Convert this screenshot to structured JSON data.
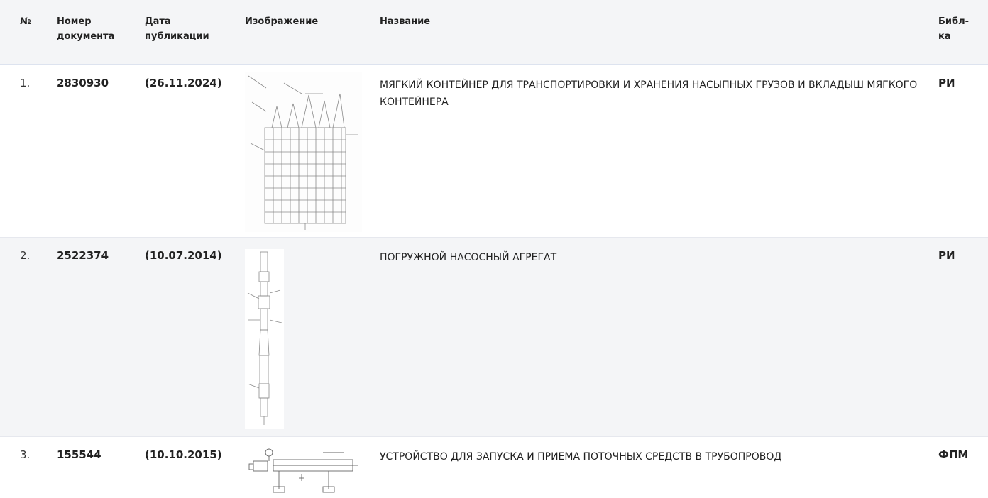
{
  "header": {
    "col_num": "№",
    "col_doc_line1": "Номер",
    "col_doc_line2": "документа",
    "col_date_line1": "Дата",
    "col_date_line2": "публикации",
    "col_image": "Изображение",
    "col_title": "Название",
    "col_lib_line1": "Библ-",
    "col_lib_line2": "ка"
  },
  "rows": [
    {
      "num": "1.",
      "doc": "2830930",
      "date": "(26.11.2024)",
      "title": "МЯГКИЙ КОНТЕЙНЕР ДЛЯ ТРАНСПОРТИРОВКИ И ХРАНЕНИЯ НАСЫПНЫХ ГРУЗОВ И ВКЛАДЫШ МЯГКОГО КОНТЕЙНЕРА",
      "lib": "РИ"
    },
    {
      "num": "2.",
      "doc": "2522374",
      "date": "(10.07.2014)",
      "title": "ПОГРУЖНОЙ НАСОСНЫЙ АГРЕГАТ",
      "lib": "РИ"
    },
    {
      "num": "3.",
      "doc": "155544",
      "date": "(10.10.2015)",
      "title": "УСТРОЙСТВО ДЛЯ ЗАПУСКА И ПРИЕМА ПОТОЧНЫХ СРЕДСТВ В ТРУБОПРОВОД",
      "lib": "ФПМ"
    }
  ],
  "colors": {
    "header_bg": "#f4f5f7",
    "row_alt_bg": "#f4f5f7",
    "border": "#dde3ef"
  }
}
